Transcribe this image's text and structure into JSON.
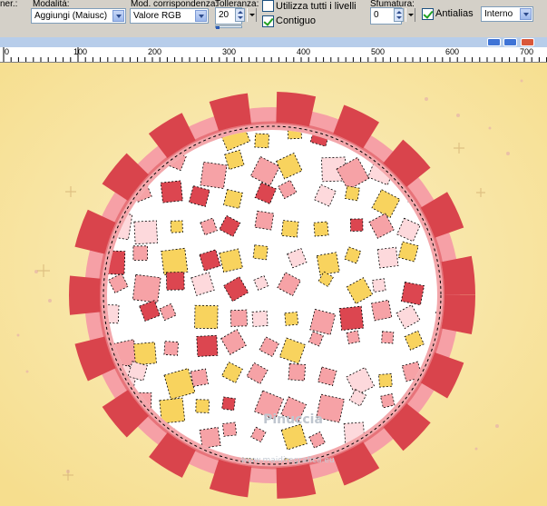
{
  "toolbar": {
    "cut_label": "ner.:",
    "mode_label": "Modalità:",
    "mode_value": "Aggiungi (Maiusc)",
    "match_label": "Mod. corrispondenza:",
    "match_value": "Valore RGB",
    "tolerance_label": "Tolleranza:",
    "tolerance_value": "20",
    "sample_all_label": "Utilizza tutti i livelli",
    "sample_all_checked": false,
    "contiguous_label": "Contiguo",
    "contiguous_checked": true,
    "feather_label": "Sfumatura:",
    "feather_value": "0",
    "antialias_label": "Antialias",
    "antialias_checked": true,
    "inside_value": "Interno"
  },
  "ruler": {
    "labels": [
      "0",
      "100",
      "200",
      "300",
      "400",
      "500",
      "600",
      "700"
    ]
  },
  "canvas": {
    "watermark": "Pinuccia",
    "watermark_url": "www.maidiregrafica.eu",
    "colors": {
      "background": "#f8e6a4",
      "frame_red": "#d9444c",
      "frame_pink": "#f6a0a6",
      "inner": "#ffffff",
      "sq_red": "#dc4650",
      "sq_pink": "#f6a2a6",
      "sq_yellow": "#f8d35e",
      "sq_light": "#fdd9dc"
    }
  }
}
